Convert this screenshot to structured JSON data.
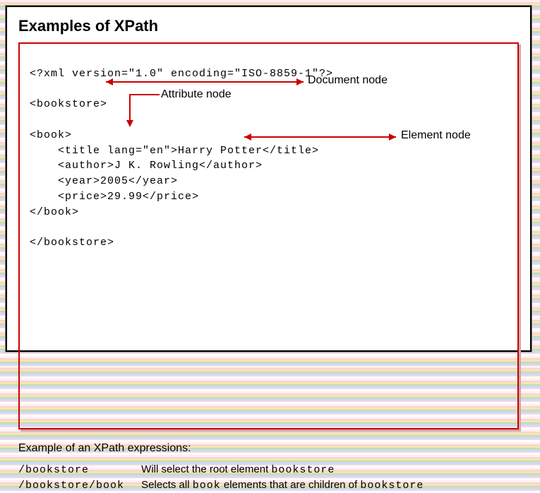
{
  "title": "Examples of XPath",
  "code": {
    "line1": "<?xml version=\"1.0\" encoding=\"ISO-8859-1\"?>",
    "line2": "<bookstore>",
    "line3": "<book>",
    "line4": "    <title lang=\"en\">Harry Potter</title>",
    "line5": "    <author>J K. Rowling</author>",
    "line6": "    <year>2005</year>",
    "line7": "    <price>29.99</price>",
    "line8": "</book>",
    "line9": "</bookstore>"
  },
  "annotations": {
    "document_node": "Document node",
    "attribute_node": "Attribute node",
    "element_node": "Element node"
  },
  "subheading": "Example of an XPath expressions:",
  "examples": {
    "row1_expr": "/bookstore",
    "row1_desc_a": "Will select the root element ",
    "row1_desc_b": "bookstore",
    "row2_expr": "/bookstore/book",
    "row2_desc_a": "Selects all ",
    "row2_desc_b": "book",
    "row2_desc_c": " elements that are children of ",
    "row2_desc_d": "bookstore"
  }
}
